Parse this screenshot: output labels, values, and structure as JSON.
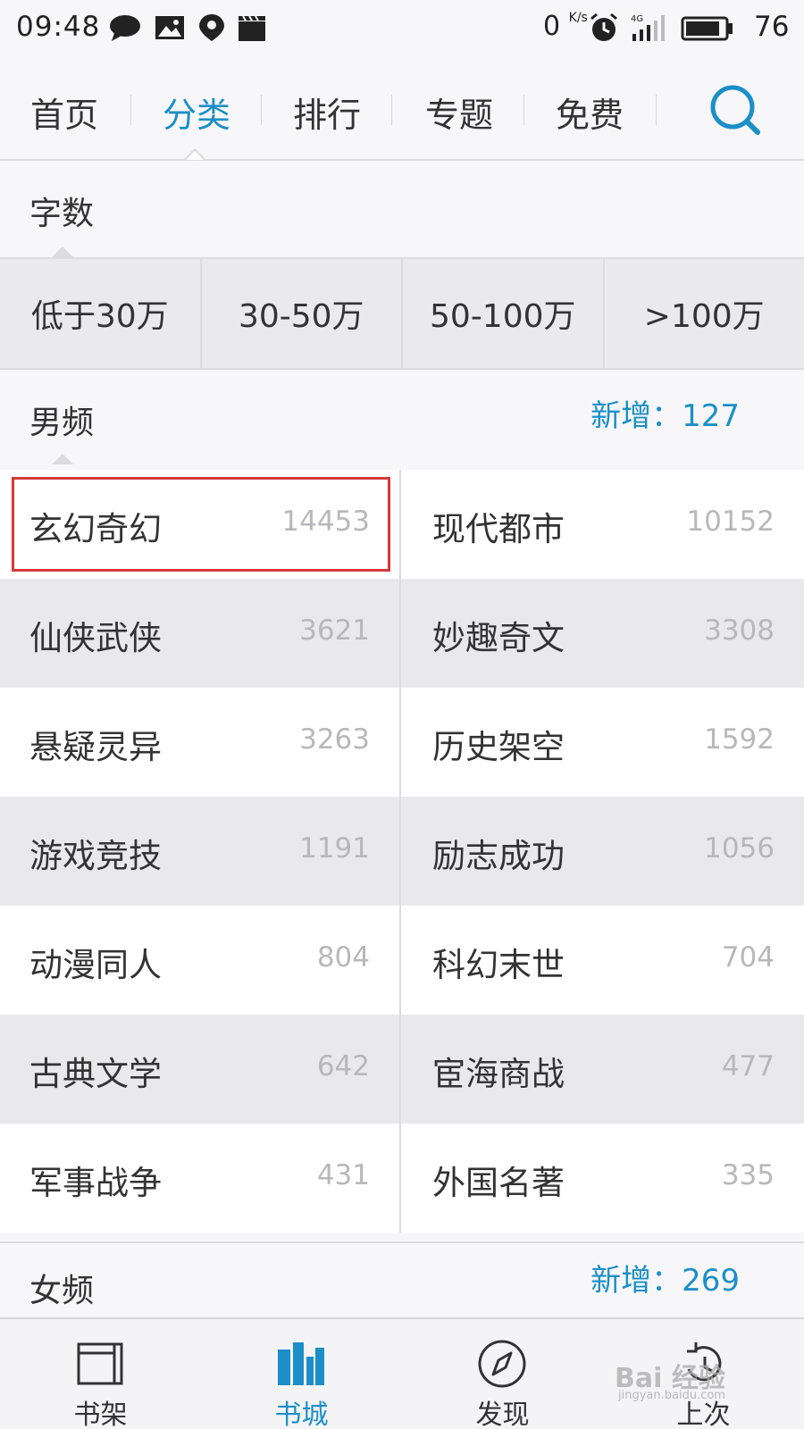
{
  "status_bar": {
    "time": "09:48",
    "net_speed": "0",
    "net_unit": "K/s",
    "signal": "4G",
    "battery": "76"
  },
  "nav": {
    "tabs": [
      "首页",
      "分类",
      "排行",
      "专题",
      "免费"
    ],
    "active_index": 1,
    "accent": "#1c8fc8"
  },
  "word_count": {
    "label": "字数",
    "options": [
      "低于30万",
      "30-50万",
      "50-100万",
      ">100万"
    ]
  },
  "male": {
    "label": "男频",
    "new_label": "新增：",
    "new_count": "127",
    "categories": [
      {
        "name": "玄幻奇幻",
        "count": "14453"
      },
      {
        "name": "现代都市",
        "count": "10152"
      },
      {
        "name": "仙侠武侠",
        "count": "3621"
      },
      {
        "name": "妙趣奇文",
        "count": "3308"
      },
      {
        "name": "悬疑灵异",
        "count": "3263"
      },
      {
        "name": "历史架空",
        "count": "1592"
      },
      {
        "name": "游戏竞技",
        "count": "1191"
      },
      {
        "name": "励志成功",
        "count": "1056"
      },
      {
        "name": "动漫同人",
        "count": "804"
      },
      {
        "name": "科幻末世",
        "count": "704"
      },
      {
        "name": "古典文学",
        "count": "642"
      },
      {
        "name": "宦海商战",
        "count": "477"
      },
      {
        "name": "军事战争",
        "count": "431"
      },
      {
        "name": "外国名著",
        "count": "335"
      }
    ]
  },
  "female": {
    "label": "女频",
    "new_label": "新增：",
    "new_count": "269"
  },
  "bottom_nav": {
    "items": [
      "书架",
      "书城",
      "发现",
      "上次"
    ],
    "active_index": 1
  },
  "watermark": {
    "text": "Bai 经验",
    "sub": "jingyan.baidu.com"
  }
}
